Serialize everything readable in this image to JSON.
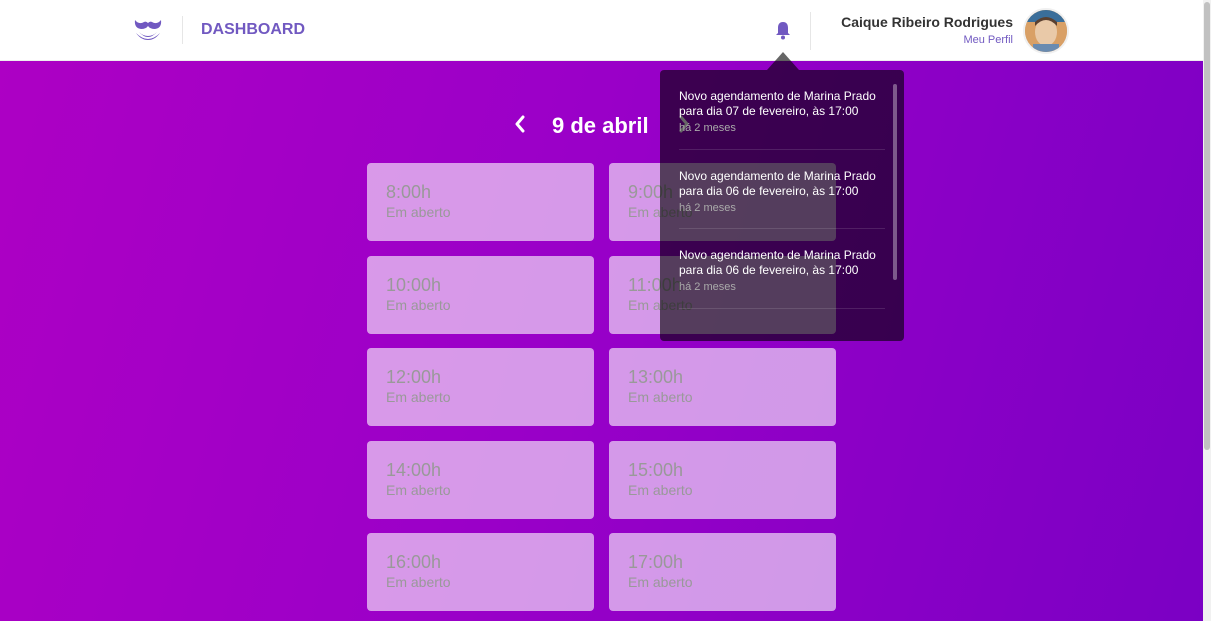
{
  "header": {
    "nav_label": "DASHBOARD",
    "user_name": "Caique Ribeiro Rodrigues",
    "profile_link": "Meu Perfil"
  },
  "date_nav": {
    "prev_icon": "chevron-left-icon",
    "next_icon": "chevron-right-icon",
    "title": "9 de abril"
  },
  "slots": [
    {
      "time": "8:00h",
      "status": "Em aberto"
    },
    {
      "time": "9:00h",
      "status": "Em aberto"
    },
    {
      "time": "10:00h",
      "status": "Em aberto"
    },
    {
      "time": "11:00h",
      "status": "Em aberto"
    },
    {
      "time": "12:00h",
      "status": "Em aberto"
    },
    {
      "time": "13:00h",
      "status": "Em aberto"
    },
    {
      "time": "14:00h",
      "status": "Em aberto"
    },
    {
      "time": "15:00h",
      "status": "Em aberto"
    },
    {
      "time": "16:00h",
      "status": "Em aberto"
    },
    {
      "time": "17:00h",
      "status": "Em aberto"
    }
  ],
  "notifications": [
    {
      "text": "Novo agendamento de Marina Prado para dia 07 de fevereiro, às 17:00",
      "time": "há 2 meses"
    },
    {
      "text": "Novo agendamento de Marina Prado para dia 06 de fevereiro, às 17:00",
      "time": "há 2 meses"
    },
    {
      "text": "Novo agendamento de Marina Prado para dia 06 de fevereiro, às 17:00",
      "time": "há 2 meses"
    }
  ],
  "colors": {
    "brand": "#7159c1",
    "gradient_start": "#ad00c4",
    "gradient_end": "#7b00c4"
  }
}
